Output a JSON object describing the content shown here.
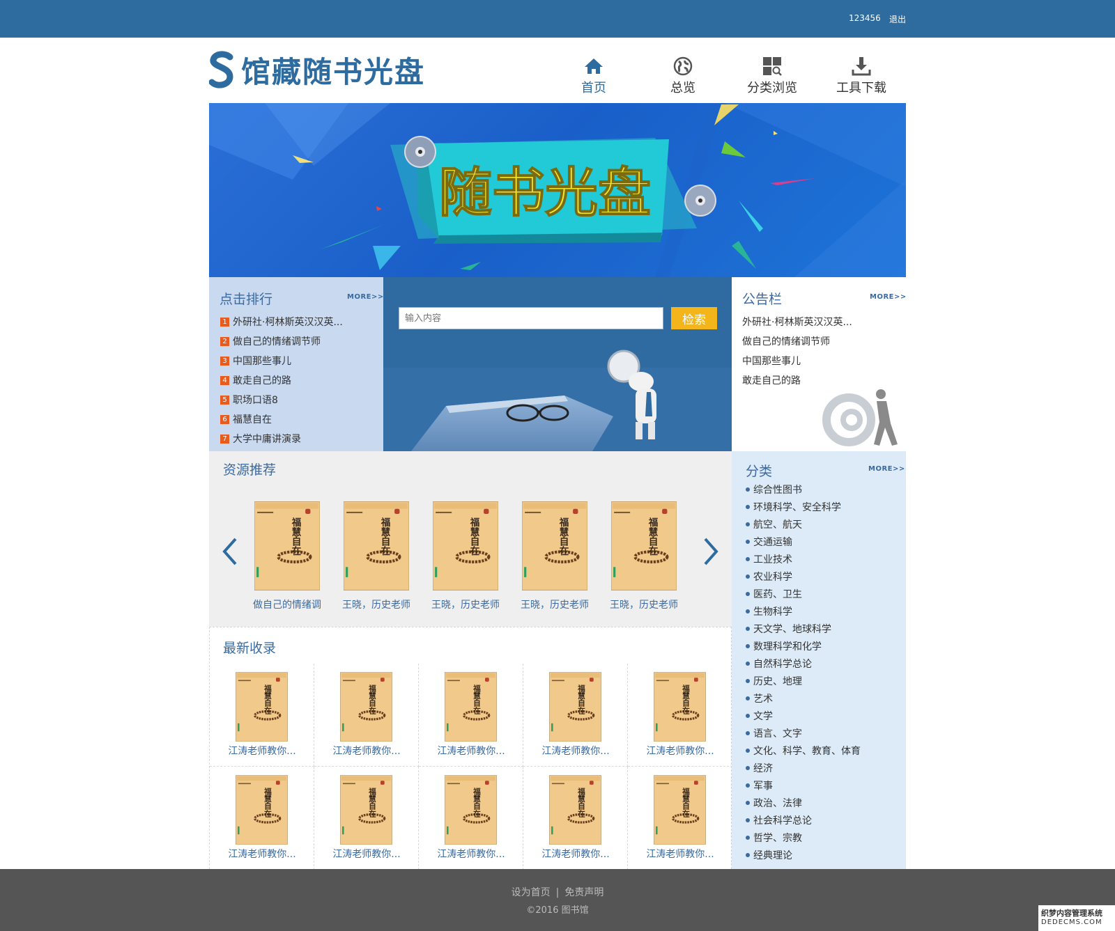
{
  "topbar": {
    "username": "123456",
    "logout_label": "退出"
  },
  "logo": {
    "title": "馆藏随书光盘"
  },
  "nav": [
    {
      "label": "首页",
      "icon": "home-icon",
      "active": true
    },
    {
      "label": "总览",
      "icon": "globe-icon",
      "active": false
    },
    {
      "label": "分类浏览",
      "icon": "category-grid-icon",
      "active": false
    },
    {
      "label": "工具下载",
      "icon": "download-icon",
      "active": false
    }
  ],
  "banner": {
    "text": "随书光盘"
  },
  "rank": {
    "title": "点击排行",
    "more": "MORE>>",
    "items": [
      {
        "num": "1",
        "title": "外研社·柯林斯英汉汉英..."
      },
      {
        "num": "2",
        "title": "做自己的情绪调节师"
      },
      {
        "num": "3",
        "title": "中国那些事儿"
      },
      {
        "num": "4",
        "title": "敢走自己的路"
      },
      {
        "num": "5",
        "title": "职场口语8"
      },
      {
        "num": "6",
        "title": "福慧自在"
      },
      {
        "num": "7",
        "title": "大学中庸讲演录"
      }
    ]
  },
  "search": {
    "placeholder": "输入内容",
    "button_label": "检索"
  },
  "notice": {
    "title": "公告栏",
    "more": "MORE>>",
    "items": [
      "外研社·柯林斯英汉汉英...",
      "做自己的情绪调节师",
      "中国那些事儿",
      "敢走自己的路"
    ]
  },
  "recommend": {
    "title": "资源推荐",
    "books": [
      "做自己的情绪调",
      "王晓，历史老师",
      "王晓，历史老师",
      "王晓，历史老师",
      "王晓，历史老师"
    ]
  },
  "newest": {
    "title": "最新收录",
    "books": [
      "江涛老师教你...",
      "江涛老师教你...",
      "江涛老师教你...",
      "江涛老师教你...",
      "江涛老师教你...",
      "江涛老师教你...",
      "江涛老师教你...",
      "江涛老师教你...",
      "江涛老师教你...",
      "江涛老师教你..."
    ]
  },
  "book_cover": {
    "title": "福慧自在"
  },
  "categories": {
    "title": "分类",
    "more": "MORE>>",
    "items": [
      "综合性图书",
      "环境科学、安全科学",
      "航空、航天",
      "交通运输",
      "工业技术",
      "农业科学",
      "医药、卫生",
      "生物科学",
      "天文学、地球科学",
      "数理科学和化学",
      "自然科学总论",
      "历史、地理",
      "艺术",
      "文学",
      "语言、文字",
      "文化、科学、教育、体育",
      "经济",
      "军事",
      "政治、法律",
      "社会科学总论",
      "哲学、宗教",
      "经典理论"
    ]
  },
  "footer": {
    "set_home": "设为首页",
    "separator": "|",
    "disclaimer": "免责声明",
    "copyright": "©2016 图书馆"
  },
  "watermark": {
    "line1": "织梦内容管理系统",
    "line2": "DEDECMS.COM"
  },
  "colors": {
    "primary": "#2e6c9f",
    "accent": "#f3b51a",
    "rank_badge": "#e95a1d",
    "footer": "#555555"
  }
}
